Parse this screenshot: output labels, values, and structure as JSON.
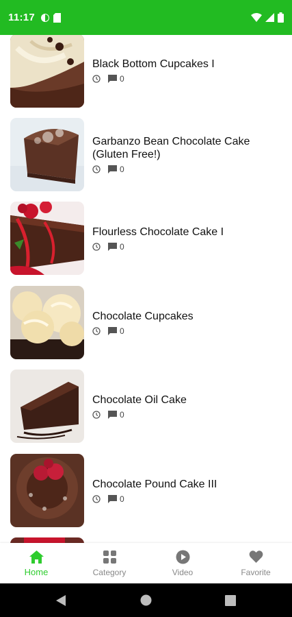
{
  "status_bar": {
    "time": "11:17"
  },
  "recipes": [
    {
      "title": "Black Bottom Cupcakes I",
      "comments": "0"
    },
    {
      "title": "Garbanzo Bean Chocolate Cake (Gluten Free!)",
      "comments": "0"
    },
    {
      "title": "Flourless Chocolate Cake I",
      "comments": "0"
    },
    {
      "title": "Chocolate Cupcakes",
      "comments": "0"
    },
    {
      "title": "Chocolate Oil Cake",
      "comments": "0"
    },
    {
      "title": "Chocolate Pound Cake III",
      "comments": "0"
    }
  ],
  "bottom_nav": {
    "home": "Home",
    "category": "Category",
    "video": "Video",
    "favorite": "Favorite"
  },
  "colors": {
    "status_bar": "#22bb22",
    "accent": "#2ecc2e",
    "inactive": "#888888"
  }
}
